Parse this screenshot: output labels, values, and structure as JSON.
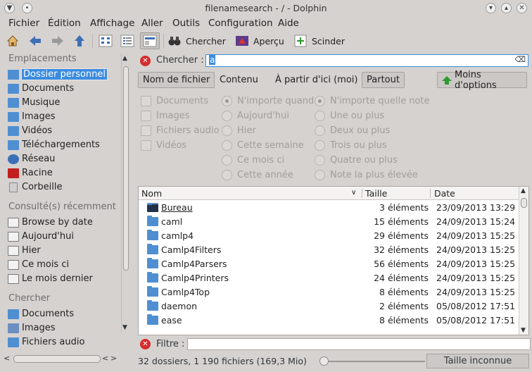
{
  "window": {
    "title": "filenamesearch - / - Dolphin"
  },
  "menubar": [
    "Fichier",
    "Édition",
    "Affichage",
    "Aller",
    "Outils",
    "Configuration",
    "Aide"
  ],
  "toolbar": {
    "search_label": "Chercher",
    "preview_label": "Aperçu",
    "split_label": "Scinder"
  },
  "sidebar": {
    "places_title": "Emplacements",
    "places": [
      "Dossier personnel",
      "Documents",
      "Musique",
      "Images",
      "Vidéos",
      "Téléchargements",
      "Réseau",
      "Racine",
      "Corbeille"
    ],
    "recent_title": "Consulté(s) récemment",
    "recent": [
      "Browse by date",
      "Aujourd'hui",
      "Hier",
      "Ce mois ci",
      "Le mois dernier"
    ],
    "search_title": "Chercher",
    "search": [
      "Documents",
      "Images",
      "Fichiers audio"
    ]
  },
  "search": {
    "label": "Chercher :",
    "value": "a"
  },
  "tabs": {
    "filename": "Nom de fichier",
    "content": "Contenu",
    "from_here": "À partir d'ici (moi)",
    "everywhere": "Partout",
    "less_options": "Moins d'options"
  },
  "options": {
    "types": [
      "Documents",
      "Images",
      "Fichiers audio",
      "Vidéos"
    ],
    "dates": [
      "N'importe quand",
      "Aujourd'hui",
      "Hier",
      "Cette semaine",
      "Ce mois ci",
      "Cette année"
    ],
    "ratings": [
      "N'importe quelle note",
      "Une ou plus",
      "Deux ou plus",
      "Trois ou plus",
      "Quatre ou plus",
      "Note la plus élevée"
    ]
  },
  "list": {
    "headers": {
      "name": "Nom",
      "size": "Taille",
      "date": "Date"
    },
    "rows": [
      {
        "name": "Bureau",
        "size": "3 éléments",
        "date": "23/09/2013 13:29"
      },
      {
        "name": "caml",
        "size": "15 éléments",
        "date": "24/09/2013 15:24"
      },
      {
        "name": "camlp4",
        "size": "29 éléments",
        "date": "24/09/2013 15:25"
      },
      {
        "name": "Camlp4Filters",
        "size": "32 éléments",
        "date": "24/09/2013 15:25"
      },
      {
        "name": "Camlp4Parsers",
        "size": "56 éléments",
        "date": "24/09/2013 15:25"
      },
      {
        "name": "Camlp4Printers",
        "size": "24 éléments",
        "date": "24/09/2013 15:25"
      },
      {
        "name": "Camlp4Top",
        "size": "8 éléments",
        "date": "24/09/2013 15:25"
      },
      {
        "name": "daemon",
        "size": "2 éléments",
        "date": "05/08/2012 17:51"
      },
      {
        "name": "ease",
        "size": "8 éléments",
        "date": "05/08/2012 17:51"
      }
    ]
  },
  "filter": {
    "label": "Filtre :"
  },
  "status": {
    "text": "32 dossiers, 1 190 fichiers (169,3 Mio)",
    "size_button": "Taille inconnue"
  }
}
